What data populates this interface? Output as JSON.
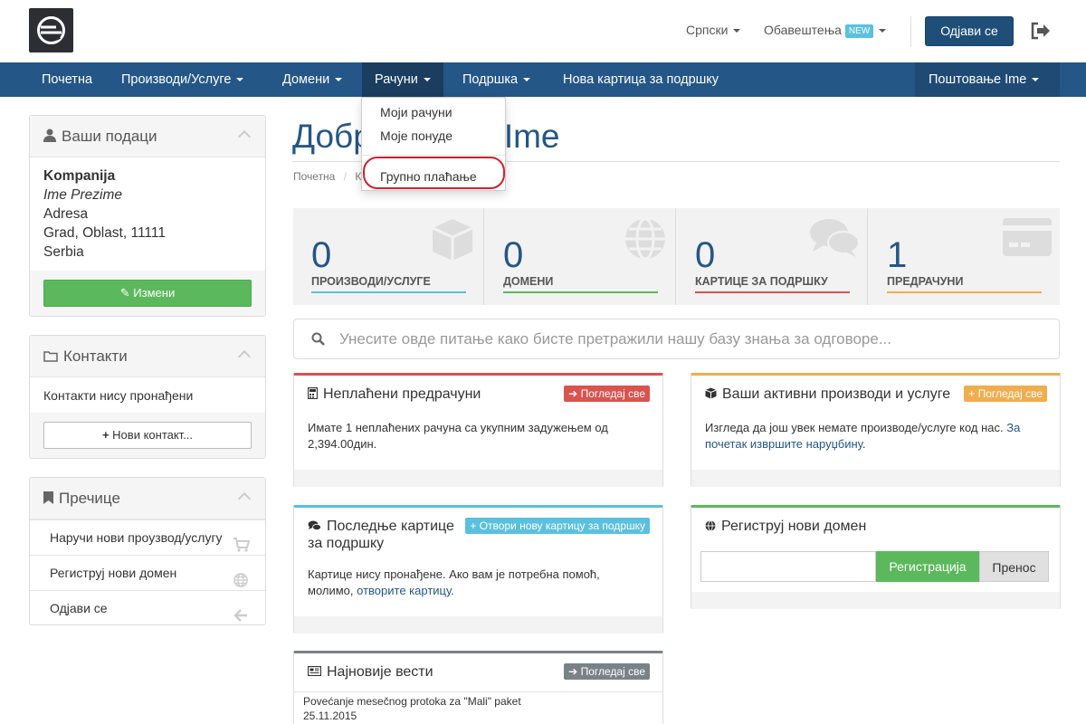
{
  "header": {
    "language": "Српски",
    "notifications": "Обавештења",
    "new_badge": "NEW",
    "logout_label": "Одјави се"
  },
  "nav": {
    "items": [
      "Почетна",
      "Производи/Услуге",
      "Домени",
      "Рачуни",
      "Подршка",
      "Нова картица за подршку"
    ],
    "greeting": "Поштовање Ime"
  },
  "dropdown": {
    "items": [
      "Моји рачуни",
      "Моје понуде",
      "Групно плаћање"
    ]
  },
  "sidebar": {
    "details": {
      "title": "Ваши подаци",
      "company": "Kompanija",
      "name": "Ime Prezime",
      "address": "Adresa",
      "city": "Grad, Oblast, 11111",
      "country": "Serbia",
      "edit_label": "Измени"
    },
    "contacts": {
      "title": "Контакти",
      "empty": "Контакти нису пронађени",
      "new_label": "Нови контакт..."
    },
    "shortcuts": {
      "title": "Пречице",
      "items": [
        "Наручи нови проузвод/услугу",
        "Региструј нови домен",
        "Одјави се"
      ]
    }
  },
  "main": {
    "title_start": "Добр",
    "title_end": "Ime",
    "breadcrumb_home": "Почетна",
    "breadcrumb_sep": "/",
    "breadcrumb_current": "К",
    "stats": [
      {
        "value": "0",
        "label": "ПРОИЗВОДИ/УСЛУГЕ",
        "color": "#5bc0de"
      },
      {
        "value": "0",
        "label": "ДОМЕНИ",
        "color": "#5cb85c"
      },
      {
        "value": "0",
        "label": "КАРТИЦЕ ЗА ПОДРШКУ",
        "color": "#d9534f"
      },
      {
        "value": "1",
        "label": "ПРЕДРАЧУНИ",
        "color": "#f0ad4e"
      }
    ],
    "search_placeholder": "Унесите овде питање како бисте претражили нашу базу знања за одговоре...",
    "cards": {
      "unpaid": {
        "title": "Неплаћени предрачуни",
        "badge": "Погледај све",
        "body": "Имате 1 неплаћених рачуна са укупним задужењем од 2,394.00дин."
      },
      "products": {
        "title": "Ваши активни производи и услуге",
        "badge": "Погледај све",
        "body_start": "Изгледа да још увек немате производе/услуге код нас.",
        "link": "За почетак извршите наруџбину",
        "body_end": "."
      },
      "tickets": {
        "title_line1": "Последње картице",
        "title_line2": "за подршку",
        "badge": "Отвори нову картицу за подршку",
        "body_start": "Картице нису пронађене. Ако вам је потребна помоћ, молимо,",
        "link": "отворите картицу",
        "body_end": "."
      },
      "domain": {
        "title": "Региструј нови домен",
        "register": "Регистрација",
        "transfer": "Пренос"
      },
      "news": {
        "title": "Најновије вести",
        "badge": "Погледај све",
        "item_title": "Povećanje mesečnog protoka za \"Mali\" paket",
        "item_date": "25.11.2015"
      }
    }
  },
  "colors": {
    "brand": "#245687",
    "navbar": "#245687",
    "success": "#5cb85c",
    "danger": "#d9534f",
    "warning": "#f0ad4e",
    "info": "#5bc0de",
    "highlight": "#d0202a"
  }
}
